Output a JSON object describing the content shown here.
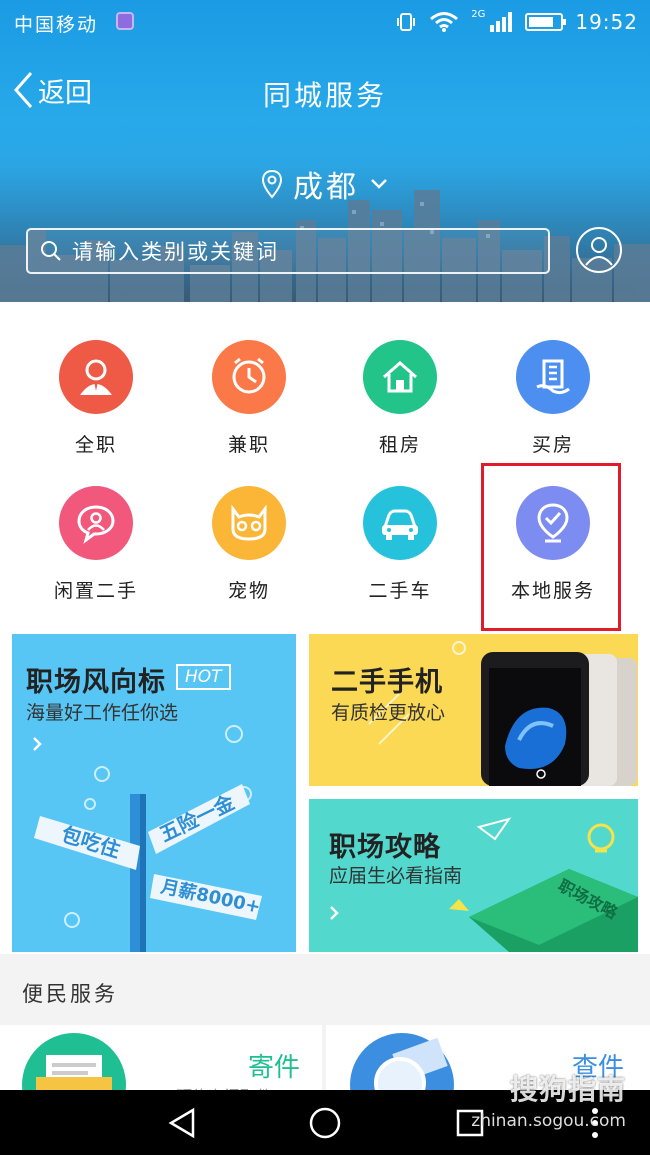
{
  "status_bar": {
    "carrier": "中国移动",
    "network": "2G",
    "time": "19:52",
    "battery_level": 0.8
  },
  "nav": {
    "back_label": "返回",
    "title": "同城服务"
  },
  "location": {
    "city": "成都"
  },
  "search": {
    "placeholder": "请输入类别或关键词"
  },
  "categories": [
    {
      "label": "全职",
      "color": "#ef5a47",
      "icon": "person-icon"
    },
    {
      "label": "兼职",
      "color": "#fb7849",
      "icon": "clock-icon"
    },
    {
      "label": "租房",
      "color": "#22c48a",
      "icon": "house-icon"
    },
    {
      "label": "买房",
      "color": "#4d8ff0",
      "icon": "building-icon"
    },
    {
      "label": "闲置二手",
      "color": "#f2577c",
      "icon": "chat-person-icon"
    },
    {
      "label": "宠物",
      "color": "#fbb638",
      "icon": "cat-icon"
    },
    {
      "label": "二手车",
      "color": "#26c2dc",
      "icon": "car-icon"
    },
    {
      "label": "本地服务",
      "color": "#7c8cf0",
      "icon": "location-check-icon"
    }
  ],
  "banners": {
    "jobs": {
      "title": "职场风向标",
      "badge": "HOT",
      "subtitle": "海量好工作任你选",
      "sign_1": "五险一金",
      "sign_2": "包吃住",
      "sign_3": "月薪8000+"
    },
    "phone": {
      "title": "二手手机",
      "subtitle": "有质检更放心"
    },
    "guide": {
      "title": "职场攻略",
      "subtitle": "应届生必看指南",
      "book_text": "职场攻略"
    }
  },
  "services": {
    "section_title": "便民服务",
    "items": [
      {
        "label": "寄件",
        "subtitle": "预约上门取件",
        "color": "#1fbf93"
      },
      {
        "label": "查件",
        "subtitle": "",
        "color": "#3c8fe0"
      }
    ]
  },
  "watermark": {
    "brand": "搜狗指南",
    "url": "zhinan.sogou.com"
  },
  "colors": {
    "highlight": "#e01c2a",
    "header": "#1b9be3"
  }
}
